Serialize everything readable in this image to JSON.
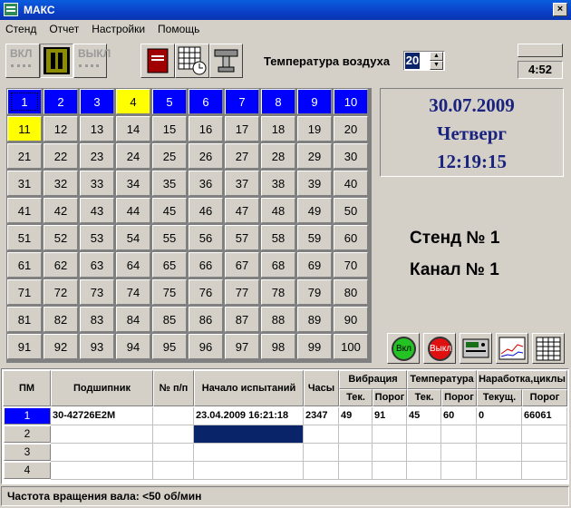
{
  "window": {
    "title": "МАКС",
    "close_label": "×"
  },
  "menu": [
    "Стенд",
    "Отчет",
    "Настройки",
    "Помощь"
  ],
  "toolbar": {
    "on_label": "ВКЛ",
    "off_label": "ВЫКЛ",
    "temp_label": "Температура воздуха",
    "temp_value": "20",
    "timer": "4:52"
  },
  "grid": {
    "cells": [
      "1",
      "2",
      "3",
      "4",
      "5",
      "6",
      "7",
      "8",
      "9",
      "10",
      "11",
      "12",
      "13",
      "14",
      "15",
      "16",
      "17",
      "18",
      "19",
      "20",
      "21",
      "22",
      "23",
      "24",
      "25",
      "26",
      "27",
      "28",
      "29",
      "30",
      "31",
      "32",
      "33",
      "34",
      "35",
      "36",
      "37",
      "38",
      "39",
      "40",
      "41",
      "42",
      "43",
      "44",
      "45",
      "46",
      "47",
      "48",
      "49",
      "50",
      "51",
      "52",
      "53",
      "54",
      "55",
      "56",
      "57",
      "58",
      "59",
      "60",
      "61",
      "62",
      "63",
      "64",
      "65",
      "66",
      "67",
      "68",
      "69",
      "70",
      "71",
      "72",
      "73",
      "74",
      "75",
      "76",
      "77",
      "78",
      "79",
      "80",
      "81",
      "82",
      "83",
      "84",
      "85",
      "86",
      "87",
      "88",
      "89",
      "90",
      "91",
      "92",
      "93",
      "94",
      "95",
      "96",
      "97",
      "98",
      "99",
      "100"
    ],
    "blue_cells": [
      1,
      2,
      3,
      5,
      6,
      7,
      8,
      9,
      10
    ],
    "yellow_cells": [
      4,
      11
    ],
    "selected_cell": 1,
    "colors": {
      "blue": "#0000ff",
      "yellow": "#ffff00"
    }
  },
  "datetime": {
    "date": "30.07.2009",
    "weekday": "Четверг",
    "time": "12:19:15"
  },
  "info": {
    "stand": "Стенд № 1",
    "channel": "Канал № 1"
  },
  "action_buttons": {
    "on": "Вкл",
    "off": "Выкл"
  },
  "table": {
    "headers": {
      "pm": "ПМ",
      "bearing": "Подшипник",
      "num": "№ п/п",
      "start": "Начало испытаний",
      "hours": "Часы",
      "vibration": "Вибрация",
      "temperature": "Температура",
      "runtime": "Наработка,циклы",
      "cur": "Тек.",
      "threshold": "Порог",
      "cur_full": "Текущ."
    },
    "row_labels": [
      "1",
      "2",
      "3",
      "4"
    ],
    "active_row": 1,
    "rows": [
      {
        "bearing": "30-42726E2M",
        "num": "",
        "start": "23.04.2009 16:21:18",
        "hours": "2347",
        "vib_cur": "49",
        "vib_thr": "91",
        "temp_cur": "45",
        "temp_thr": "60",
        "run_cur": "0",
        "run_thr": "66061"
      }
    ]
  },
  "status": {
    "text": "Частота вращения вала:  <50 об/мин"
  }
}
